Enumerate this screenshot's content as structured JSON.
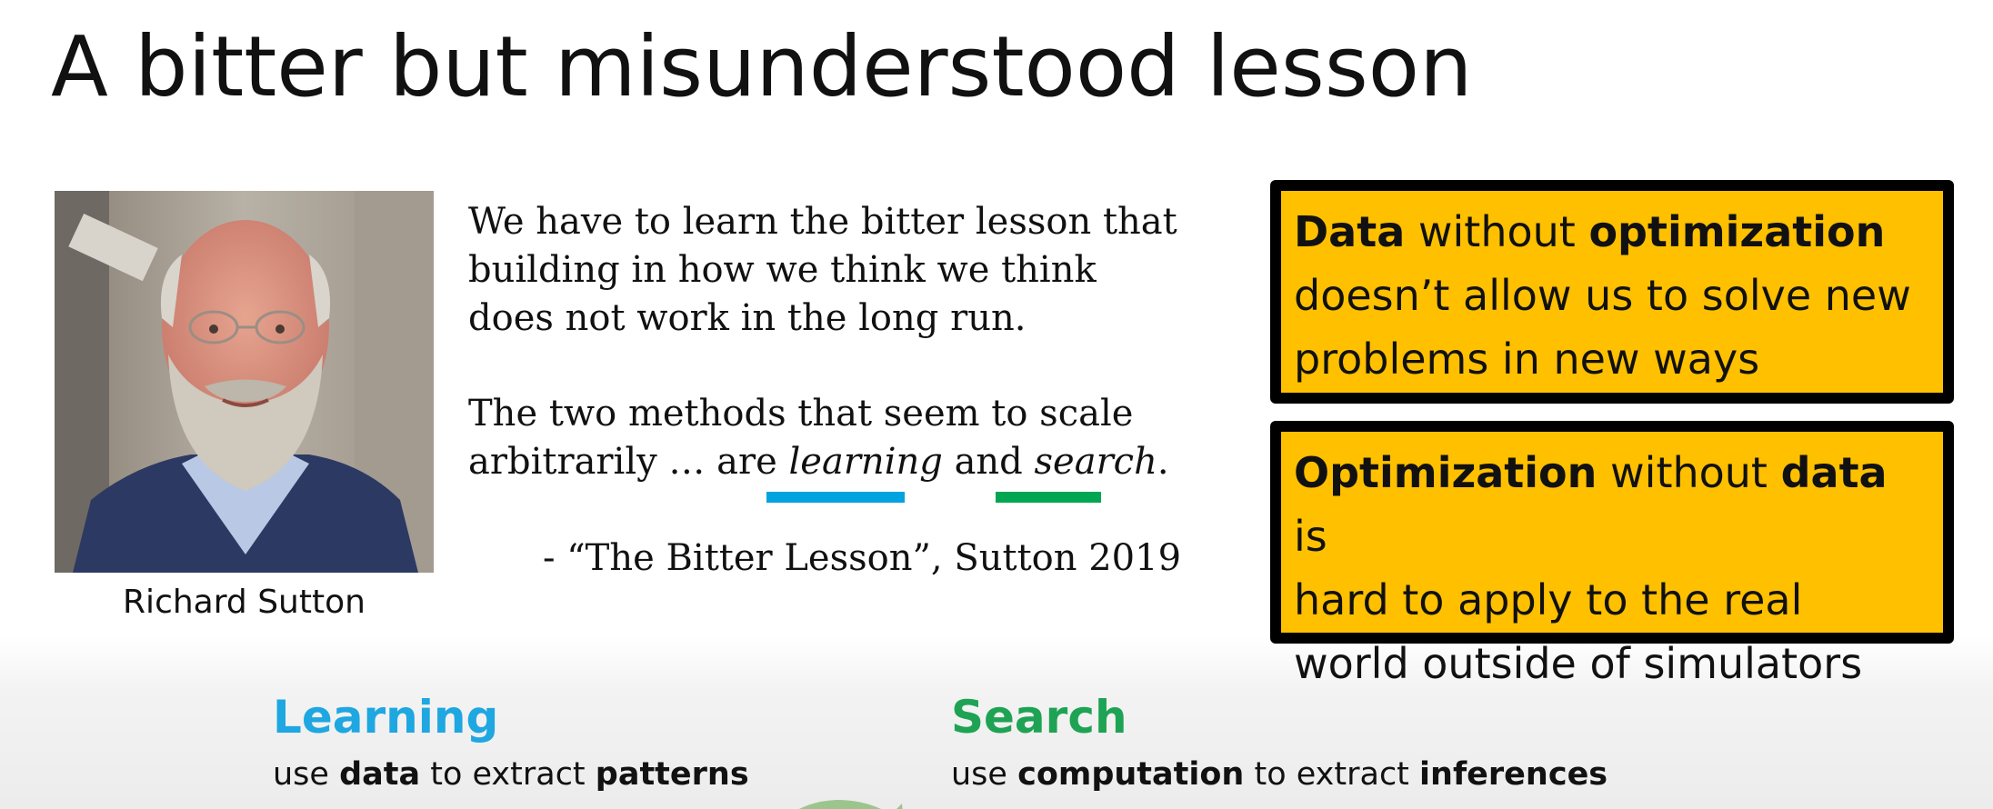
{
  "slide": {
    "title": "A bitter but misunderstood lesson"
  },
  "person": {
    "caption": "Richard Sutton"
  },
  "quote": {
    "line1": "We have to learn the bitter lesson that",
    "line2": "building in how we think we think",
    "line3": "does not work in the long run.",
    "line4": "The two methods that seem to scale",
    "line5_pre": "arbitrarily … are ",
    "line5_learning": "learning",
    "line5_mid": " and ",
    "line5_search": "search",
    "line5_post": ".",
    "attribution": "- “The Bitter Lesson”, Sutton 2019",
    "underline_colors": {
      "learning": "#00a3e0",
      "search": "#00a651"
    }
  },
  "box1": {
    "w1": "Data",
    "w2": " without ",
    "w3": "optimization",
    "line2": "doesn’t allow us to solve new",
    "line3": "problems in new ways"
  },
  "box2": {
    "w1": "Optimization",
    "w2": " without ",
    "w3": "data",
    "w4": " is",
    "line2": "hard to apply to the real",
    "line3": "world outside of simulators"
  },
  "box_colors": {
    "fill": "#ffc000",
    "border": "#000000"
  },
  "learning": {
    "title": "Learning",
    "d1": "use ",
    "d2": "data",
    "d3": " to extract ",
    "d4": "patterns",
    "color": "#1ea7e1"
  },
  "search": {
    "title": "Search",
    "d1": "use ",
    "d2": "computation",
    "d3": " to extract ",
    "d4": "inferences",
    "color": "#1ea354"
  }
}
